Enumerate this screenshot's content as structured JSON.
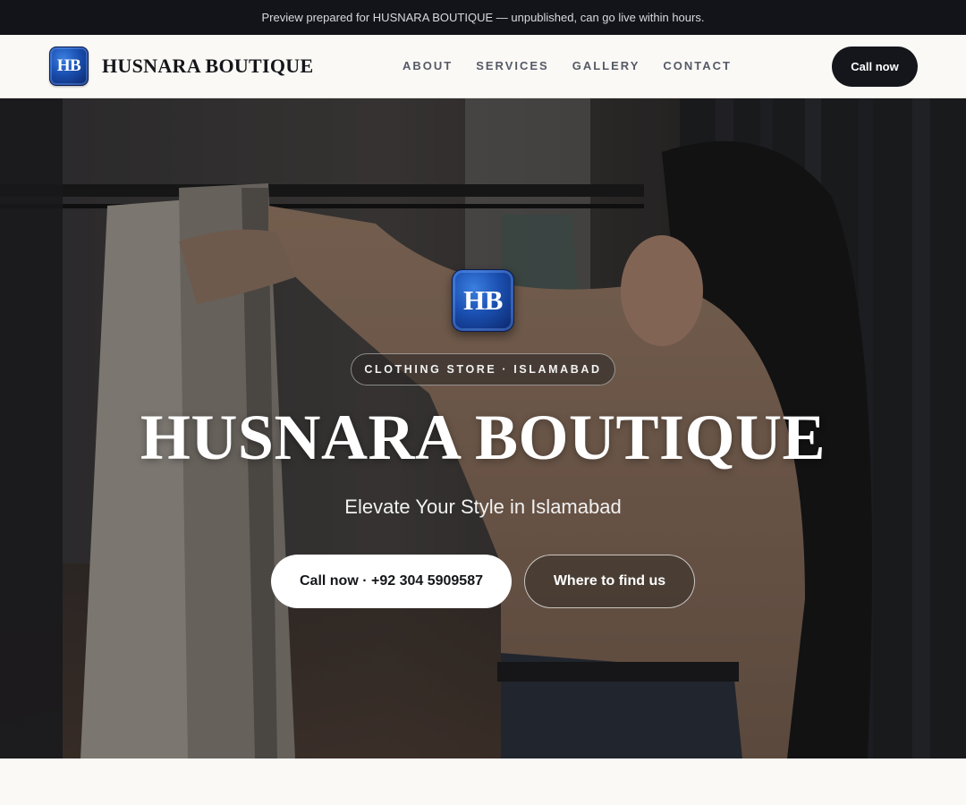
{
  "banner": {
    "text": "Preview prepared for HUSNARA BOUTIQUE — unpublished, can go live within hours."
  },
  "header": {
    "logo_text": "HB",
    "brand": "HUSNARA BOUTIQUE",
    "nav": [
      "ABOUT",
      "SERVICES",
      "GALLERY",
      "CONTACT"
    ],
    "cta": "Call now"
  },
  "hero": {
    "logo_text": "HB",
    "tagline": "CLOTHING STORE · ISLAMABAD",
    "title": "HUSNARA BOUTIQUE",
    "subtitle": "Elevate Your Style in Islamabad",
    "primary_button": "Call now · +92 304 5909587",
    "secondary_button": "Where to find us"
  },
  "colors": {
    "dark": "#12141a",
    "badge_blue": "#1a4fb0",
    "page_bg": "#faf9f6"
  }
}
